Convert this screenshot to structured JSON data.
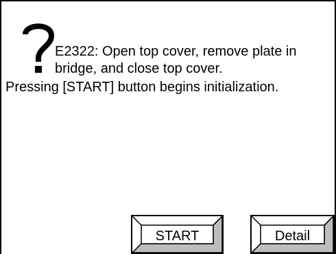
{
  "dialog": {
    "icon": "question-mark-icon",
    "message_lines": [
      "E2322: Open top cover, remove plate in",
      "bridge, and close top cover.",
      "Pressing [START] button begins initialization."
    ]
  },
  "buttons": {
    "start_label": "START",
    "detail_label": "Detail"
  },
  "colors": {
    "background": "#ffffff",
    "foreground": "#000000",
    "bevel_shade": "#bdbdbd"
  }
}
